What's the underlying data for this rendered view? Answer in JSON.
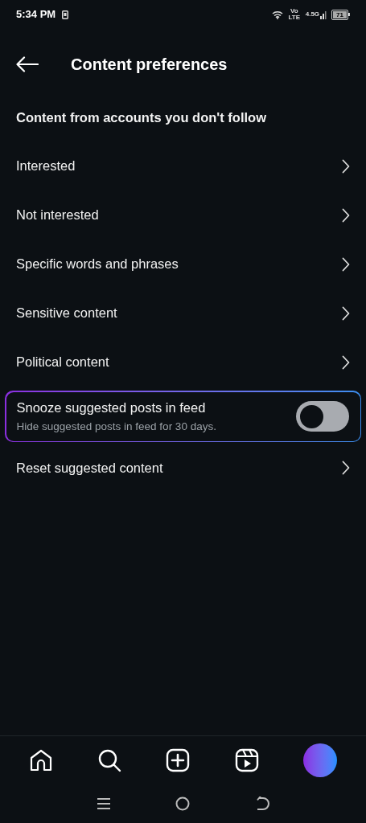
{
  "status_bar": {
    "time": "5:34 PM",
    "volte": "Vo LTE",
    "network": "4.5G",
    "battery": "71"
  },
  "header": {
    "title": "Content preferences"
  },
  "section": {
    "title": "Content from accounts you don't follow"
  },
  "items": [
    {
      "kind": "link",
      "label": "Interested"
    },
    {
      "kind": "link",
      "label": "Not interested"
    },
    {
      "kind": "link",
      "label": "Specific words and phrases"
    },
    {
      "kind": "link",
      "label": "Sensitive content"
    },
    {
      "kind": "link",
      "label": "Political content"
    },
    {
      "kind": "toggle",
      "label": "Snooze suggested posts in feed",
      "description": "Hide suggested posts in feed for 30 days.",
      "on": false
    },
    {
      "kind": "link",
      "label": "Reset suggested content"
    }
  ]
}
